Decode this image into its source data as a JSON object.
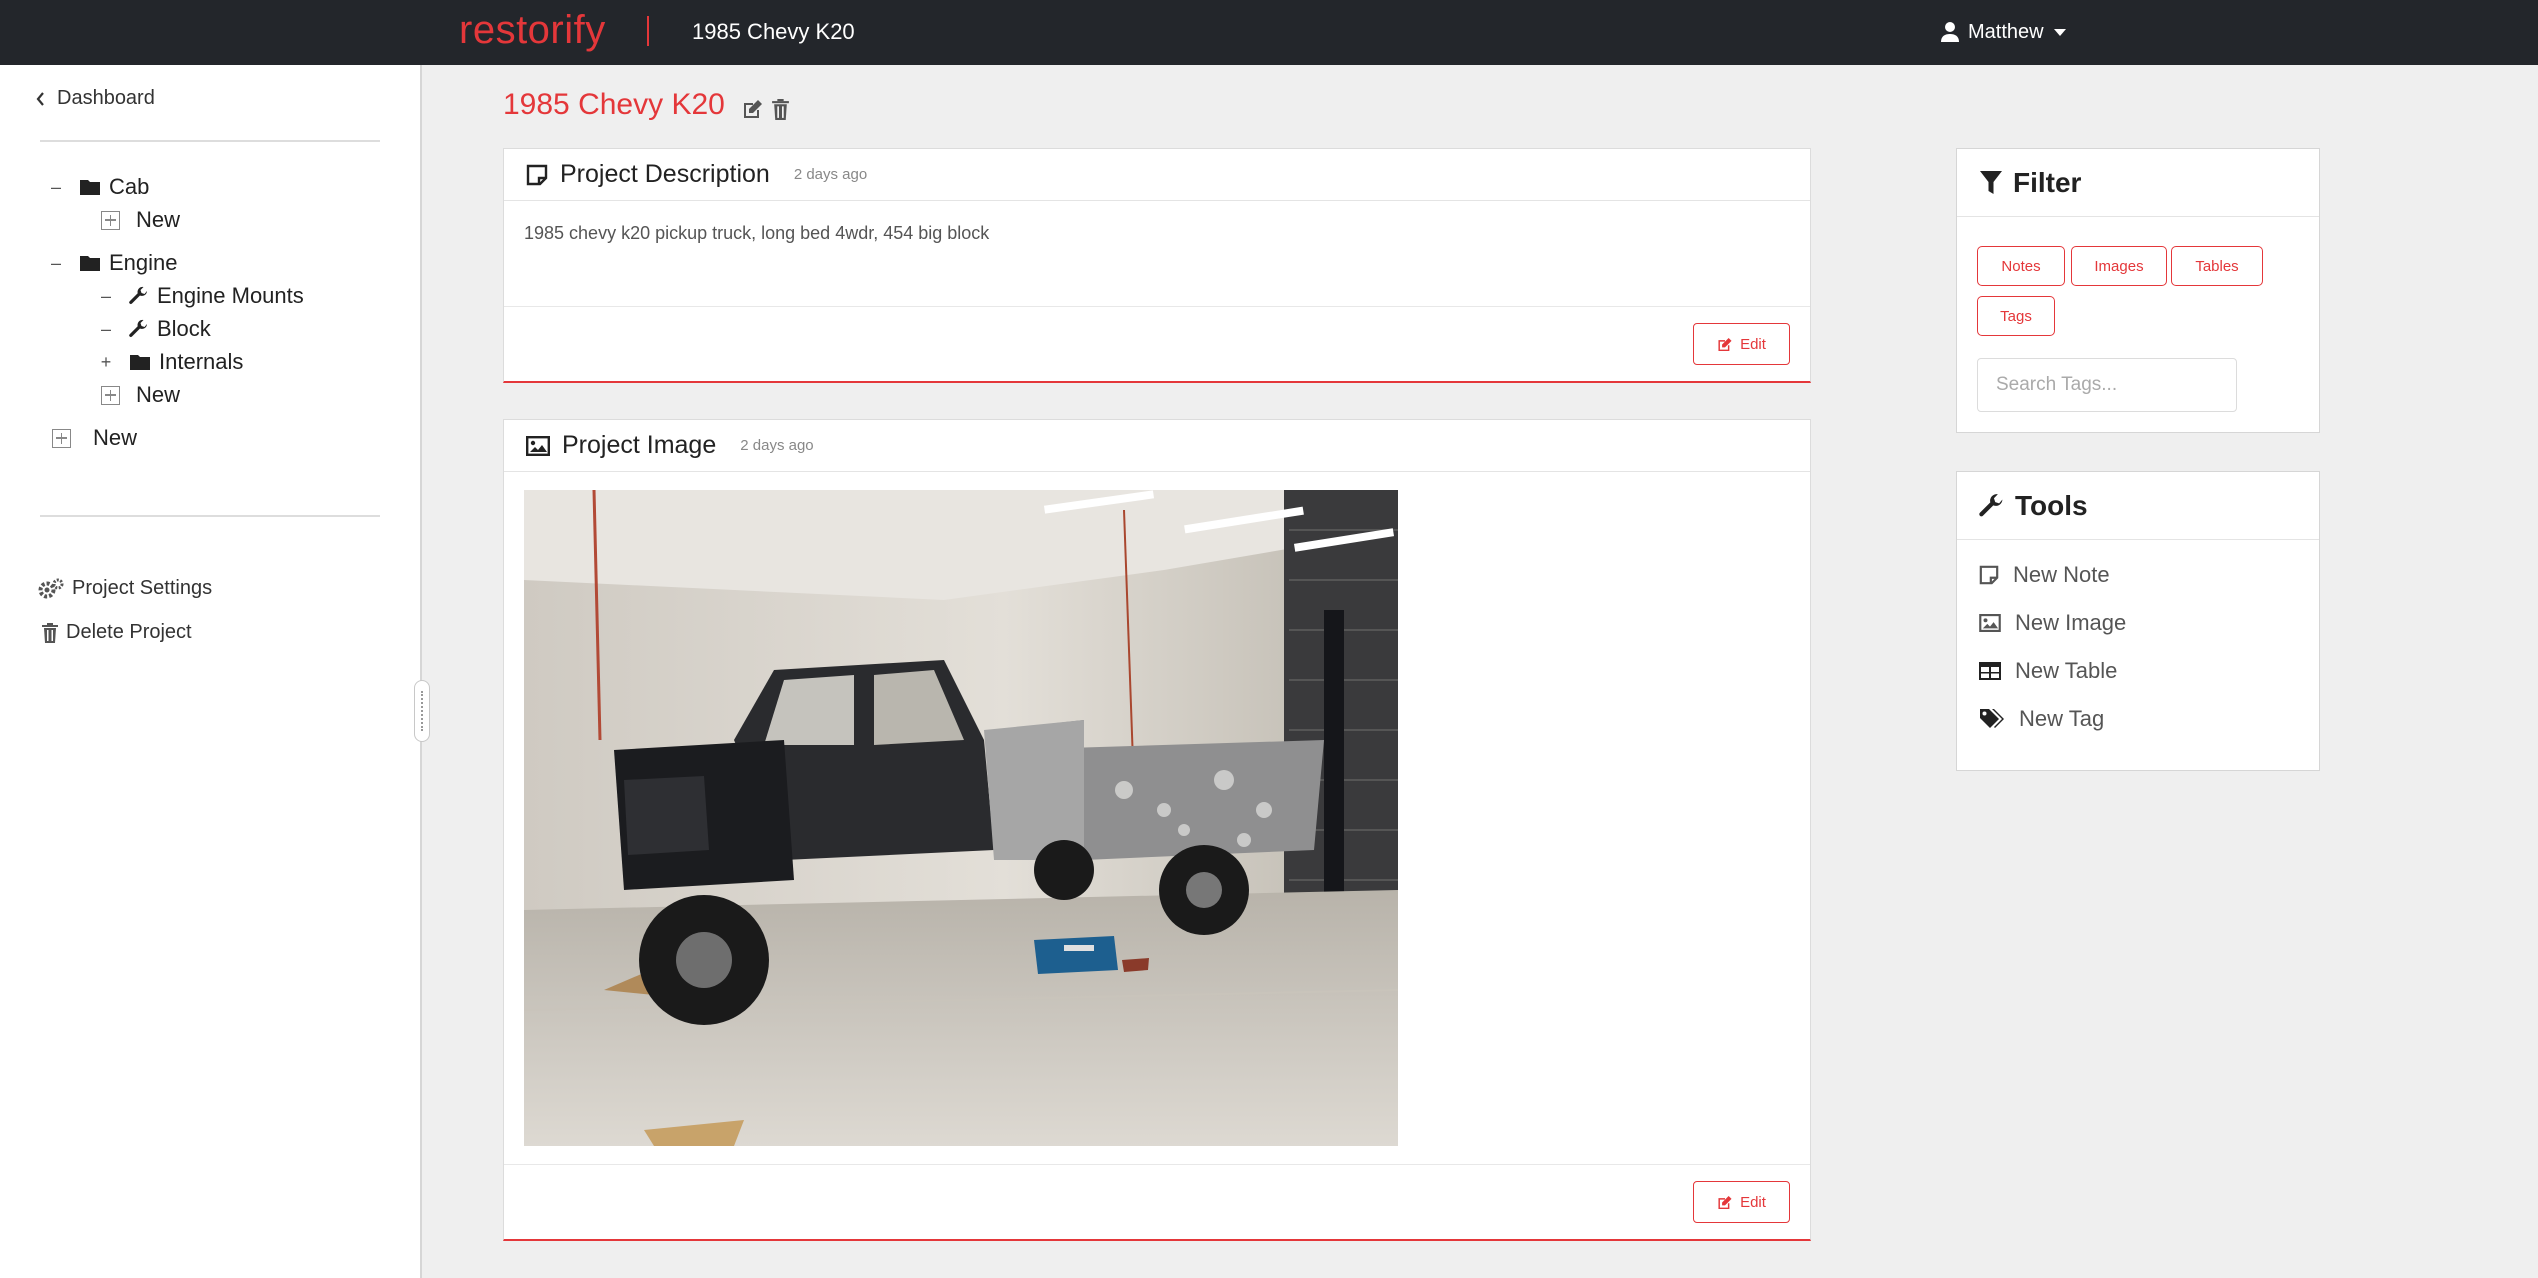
{
  "nav": {
    "brand": "restorify",
    "project": "1985 Chevy K20",
    "user": "Matthew"
  },
  "sidebar": {
    "dashboard": "Dashboard",
    "tree": [
      {
        "toggle": "–",
        "type": "folder",
        "label": "Cab"
      },
      {
        "toggle": "",
        "type": "new",
        "label": "New"
      },
      {
        "toggle": "–",
        "type": "folder",
        "label": "Engine"
      },
      {
        "toggle": "–",
        "type": "wrench",
        "label": "Engine Mounts"
      },
      {
        "toggle": "–",
        "type": "wrench",
        "label": "Block"
      },
      {
        "toggle": "+",
        "type": "folder",
        "label": "Internals"
      },
      {
        "toggle": "",
        "type": "new",
        "label": "New"
      },
      {
        "toggle": "",
        "type": "new",
        "label": "New"
      }
    ],
    "settings": "Project Settings",
    "delete": "Delete Project"
  },
  "page": {
    "title": "1985 Chevy K20"
  },
  "description_card": {
    "title": "Project Description",
    "time": "2 days ago",
    "text": "1985 chevy k20 pickup truck, long bed 4wdr, 454 big block",
    "edit": "Edit"
  },
  "image_card": {
    "title": "Project Image",
    "time": "2 days ago",
    "edit": "Edit"
  },
  "filter": {
    "title": "Filter",
    "buttons": [
      "Notes",
      "Images",
      "Tables",
      "Tags"
    ],
    "search_placeholder": "Search Tags..."
  },
  "tools": {
    "title": "Tools",
    "items": [
      {
        "icon": "note-icon",
        "label": "New Note"
      },
      {
        "icon": "image-icon",
        "label": "New Image"
      },
      {
        "icon": "table-icon",
        "label": "New Table"
      },
      {
        "icon": "tags-icon",
        "label": "New Tag"
      }
    ]
  },
  "colors": {
    "accent": "#e4373a",
    "navbar": "#23262b",
    "background": "#efefef"
  }
}
